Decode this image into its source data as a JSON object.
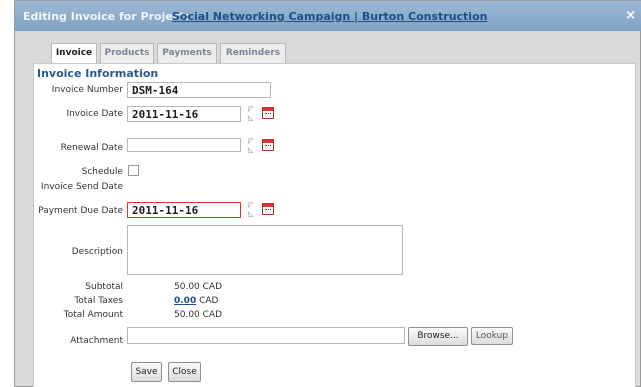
{
  "dialog": {
    "title_prefix": "Editing Invoice for Project:",
    "project_link": "Social Networking Campaign | Burton Construction",
    "close_glyph": "×"
  },
  "tabs": [
    {
      "label": "Invoice",
      "active": true
    },
    {
      "label": "Products",
      "active": false
    },
    {
      "label": "Payments",
      "active": false
    },
    {
      "label": "Reminders",
      "active": false
    }
  ],
  "section": {
    "title": "Invoice Information"
  },
  "fields": {
    "invoice_number": {
      "label": "Invoice Number",
      "value": "DSM-164"
    },
    "invoice_date": {
      "label": "Invoice Date",
      "value": "2011-11-16"
    },
    "renewal_date": {
      "label": "Renewal Date",
      "value": ""
    },
    "schedule": {
      "label": "Schedule",
      "label2": "Invoice Send Date",
      "checked": false
    },
    "payment_due_date": {
      "label": "Payment Due Date",
      "value": "2011-11-16"
    },
    "description": {
      "label": "Description",
      "value": ""
    }
  },
  "totals": {
    "subtotal_label": "Subtotal",
    "subtotal_value": "50.00 CAD",
    "taxes_label": "Total Taxes",
    "taxes_link": "0.00",
    "taxes_currency": "CAD",
    "amount_label": "Total Amount",
    "amount_value": "50.00 CAD"
  },
  "attachment": {
    "label": "Attachment",
    "browse": "Browse...",
    "lookup": "Lookup"
  },
  "actions": {
    "save": "Save",
    "close": "Close"
  },
  "icons": {
    "date_stepper": "up-down-arrows-icon",
    "calendar": "calendar-icon",
    "close": "close-icon"
  },
  "colors": {
    "titlebar": "#8fb0cf",
    "link": "#1f4f86",
    "section_title": "#2c5a88",
    "error_border": "#e03030"
  }
}
